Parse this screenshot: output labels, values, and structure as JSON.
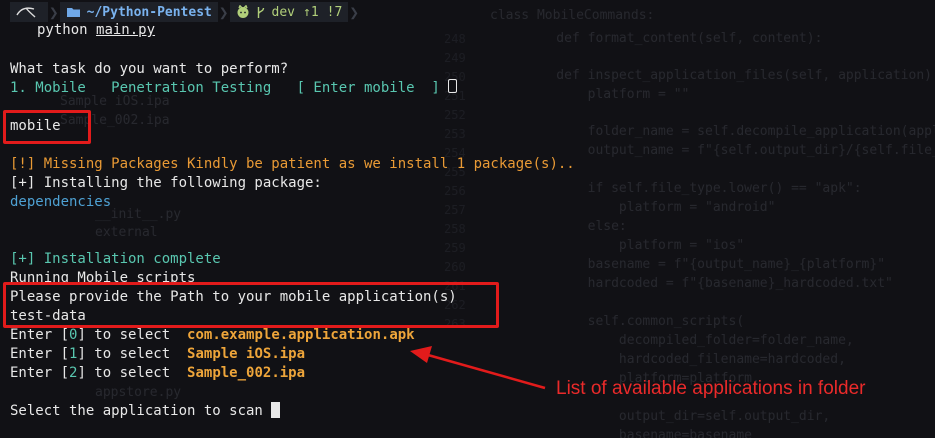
{
  "prompt": {
    "path": "~/Python-Pentest",
    "branch": "dev",
    "ahead": "↑1",
    "modified": "!7",
    "icons": [
      "kali-dragon-icon",
      "folder-icon",
      "github-icon",
      "git-branch-icon"
    ]
  },
  "command": {
    "program": "python",
    "arg": "main.py"
  },
  "output": {
    "question": "What task do you want to perform?",
    "option": "1. Mobile   Penetration Testing   [ Enter mobile  ] ",
    "user_input": "mobile",
    "missing": "[!] Missing Packages Kindly be patient as we install 1 package(s)..",
    "installing": "[+] Installing the following package:",
    "package": "dependencies",
    "complete": "[+] Installation complete",
    "running": "Running Mobile scripts",
    "path_prompt": "Please provide the Path to your mobile application(s)",
    "path_input": "test-data",
    "apps": [
      {
        "prefix": "Enter [",
        "index": "0",
        "suffix": "] to select  ",
        "name": "com.example.application.apk"
      },
      {
        "prefix": "Enter [",
        "index": "1",
        "suffix": "] to select  ",
        "name": "Sample iOS.ipa"
      },
      {
        "prefix": "Enter [",
        "index": "2",
        "suffix": "] to select  ",
        "name": "Sample_002.ipa"
      }
    ],
    "select_prompt": "Select the application to scan "
  },
  "annotation": {
    "text": "List of available applications in folder",
    "color": "#ea2a2a"
  },
  "background_code": {
    "line_numbers": [
      "248",
      "249",
      "250",
      "251",
      "252",
      "253",
      "254",
      "255",
      "256",
      "257",
      "258",
      "259",
      "260",
      "261",
      "262",
      "263"
    ],
    "lines": [
      "class MobileCommands:",
      "    def format_content(self, content):",
      "    def inspect_application_files(self, application):",
      "        platform = \"\"",
      "        folder_name = self.decompile_application(application)",
      "        output_name = f\"{self.output_dir}/{self.file_name}\"",
      "        if self.file_type.lower() == \"apk\":",
      "            platform = \"android\"",
      "        else:",
      "            platform = \"ios\"",
      "        basename = f\"{output_name}_{platform}\"",
      "        hardcoded = f\"{basename}_hardcoded.txt\"",
      "        self.common_scripts(",
      "            decompiled_folder=folder_name,",
      "            hardcoded_filename=hardcoded,",
      "            platform=platform,",
      "            output_dir=self.output_dir,",
      "            basename=basename"
    ],
    "tree_items": [
      "Sample iOS.ipa",
      "Sample_002.ipa",
      "external",
      "__init__.py",
      "appstore.py"
    ]
  }
}
